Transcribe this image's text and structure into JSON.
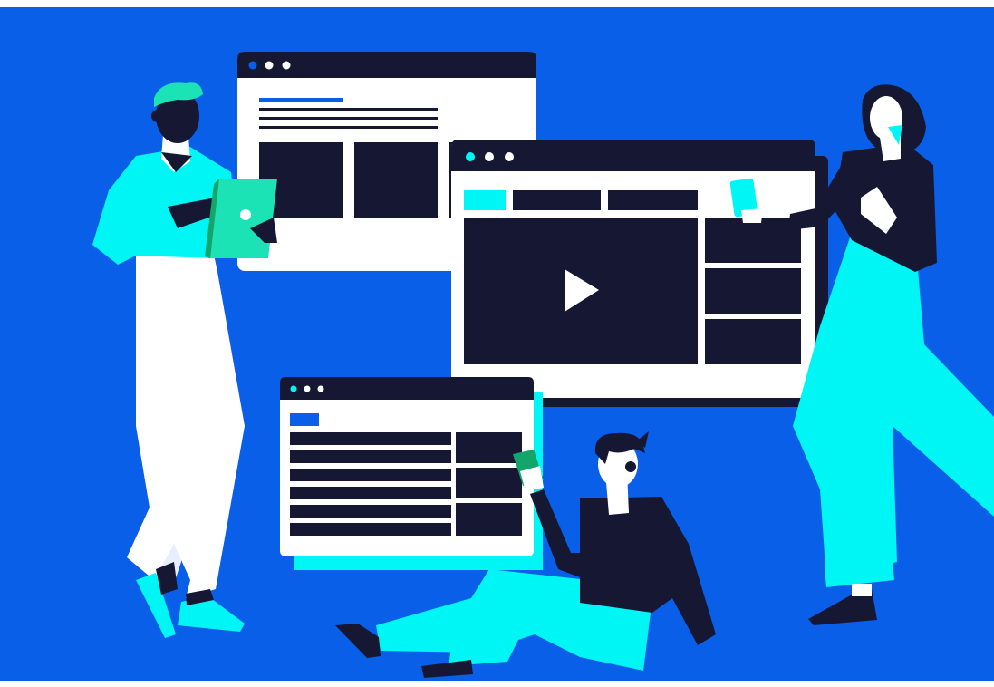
{
  "colors": {
    "background": "#0A5FE8",
    "navy": "#161833",
    "cyan": "#00F5F5",
    "white": "#FFFFFF",
    "mint": "#1BE3B5",
    "green": "#13A56A",
    "blue_accent": "#0A5FE8",
    "skin": "#FFFFFF"
  },
  "icons": {
    "play": "play-icon",
    "window_dots": "window-control-dots-icon"
  }
}
